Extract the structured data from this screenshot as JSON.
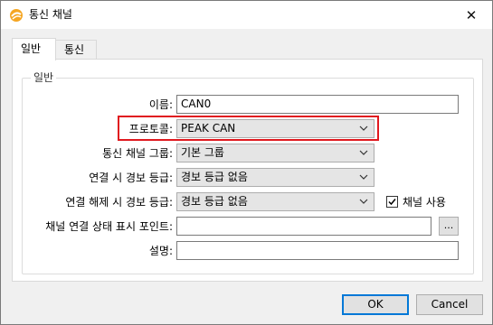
{
  "window": {
    "title": "통신 채널",
    "close_glyph": "✕"
  },
  "tabs": [
    {
      "label": "일반",
      "active": true
    },
    {
      "label": "통신",
      "active": false
    }
  ],
  "group": {
    "title": "일반"
  },
  "form": {
    "name": {
      "label": "이름:",
      "value": "CAN0"
    },
    "protocol": {
      "label": "프로토콜:",
      "value": "PEAK CAN"
    },
    "comm_group": {
      "label": "통신 채널 그룹:",
      "value": "기본 그룹"
    },
    "connect_alarm": {
      "label": "연결 시 경보 등급:",
      "value": "경보 등급 없음"
    },
    "disconnect_alarm": {
      "label": "연결 해제 시 경보 등급:",
      "value": "경보 등급 없음"
    },
    "use_channel": {
      "label": "채널 사용",
      "checked": true
    },
    "status_point": {
      "label": "채널 연결 상태 표시 포인트:",
      "value": "",
      "browse_label": "..."
    },
    "description": {
      "label": "설명:",
      "value": ""
    }
  },
  "buttons": {
    "ok": "OK",
    "cancel": "Cancel"
  },
  "colors": {
    "highlight": "#e0191f",
    "default_button_border": "#0078d7"
  }
}
